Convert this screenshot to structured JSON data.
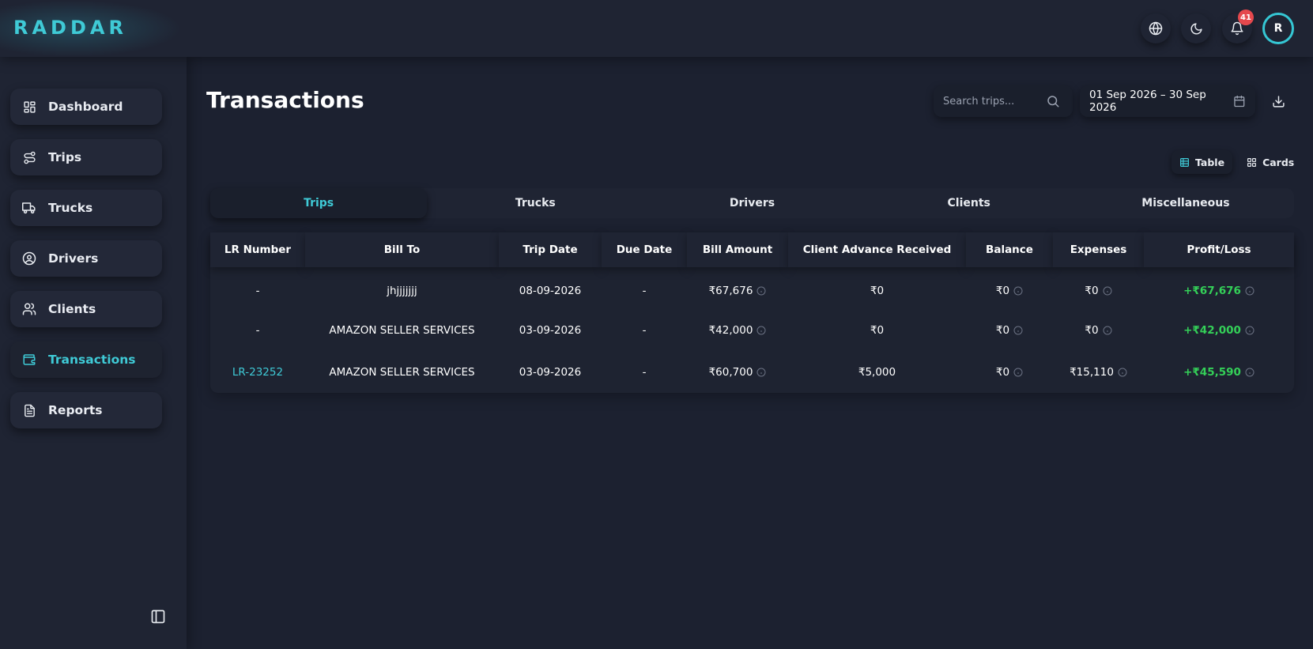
{
  "app": {
    "logo_text": "RADDAR"
  },
  "header": {
    "notification_count": "41",
    "avatar_initial": "R",
    "colors": {
      "accent": "#3fcad6",
      "badge": "#e5484d"
    }
  },
  "sidebar": {
    "items": [
      {
        "label": "Dashboard",
        "icon": "dashboard-icon"
      },
      {
        "label": "Trips",
        "icon": "route-icon"
      },
      {
        "label": "Trucks",
        "icon": "truck-icon"
      },
      {
        "label": "Drivers",
        "icon": "user-circle-icon"
      },
      {
        "label": "Clients",
        "icon": "users-icon"
      },
      {
        "label": "Transactions",
        "icon": "wallet-icon",
        "active": true
      },
      {
        "label": "Reports",
        "icon": "file-text-icon"
      }
    ]
  },
  "main": {
    "title": "Transactions",
    "search": {
      "placeholder": "Search trips...",
      "value": ""
    },
    "date_range": "01 Sep 2026 – 30 Sep 2026",
    "view_toggle": {
      "table": "Table",
      "cards": "Cards",
      "active": "Table"
    },
    "tabs": [
      {
        "label": "Trips",
        "active": true
      },
      {
        "label": "Trucks"
      },
      {
        "label": "Drivers"
      },
      {
        "label": "Clients"
      },
      {
        "label": "Miscellaneous"
      }
    ],
    "table": {
      "columns": [
        "LR Number",
        "Bill To",
        "Trip Date",
        "Due Date",
        "Bill Amount",
        "Client Advance Received",
        "Balance",
        "Expenses",
        "Profit/Loss"
      ],
      "rows": [
        {
          "lr": "-",
          "bill_to": "jhjjjjjjj",
          "trip_date": "08-09-2026",
          "due_date": "-",
          "bill_amount": "₹67,676",
          "advance": "₹0",
          "balance": "₹0",
          "expenses": "₹0",
          "profit": "+₹67,676"
        },
        {
          "lr": "-",
          "bill_to": "AMAZON SELLER SERVICES",
          "trip_date": "03-09-2026",
          "due_date": "-",
          "bill_amount": "₹42,000",
          "advance": "₹0",
          "balance": "₹0",
          "expenses": "₹0",
          "profit": "+₹42,000"
        },
        {
          "lr": "LR-23252",
          "bill_to": "AMAZON SELLER SERVICES",
          "trip_date": "03-09-2026",
          "due_date": "-",
          "bill_amount": "₹60,700",
          "advance": "₹5,000",
          "balance": "₹0",
          "expenses": "₹15,110",
          "profit": "+₹45,590"
        }
      ]
    }
  }
}
